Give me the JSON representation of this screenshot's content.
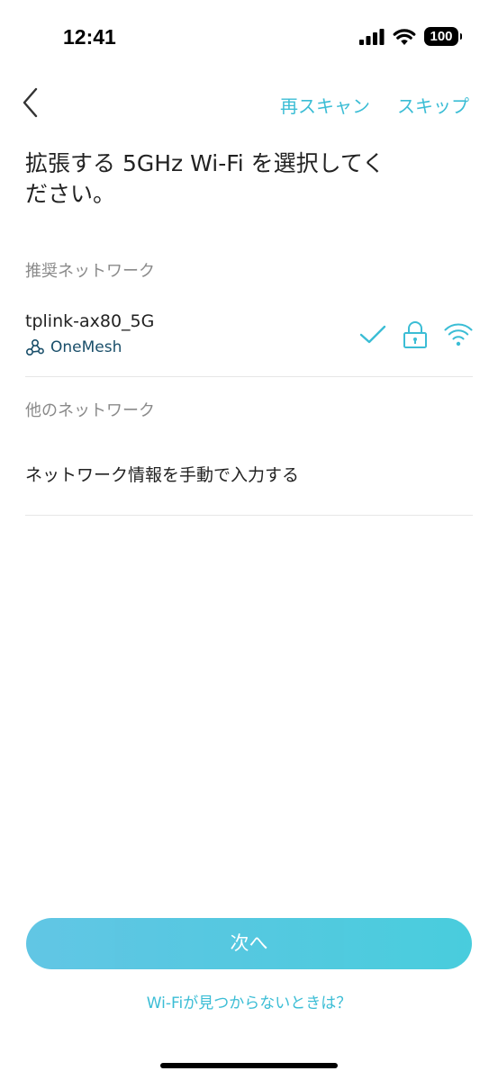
{
  "status_bar": {
    "time": "12:41",
    "battery": "100",
    "icons": [
      "cellular-signal-icon",
      "wifi-icon",
      "battery-icon"
    ]
  },
  "nav": {
    "back_icon": "chevron-left-icon",
    "rescan_label": "再スキャン",
    "skip_label": "スキップ"
  },
  "title": "拡張する 5GHz Wi-Fi を選択してください。",
  "recommended": {
    "header": "推奨ネットワーク",
    "network": {
      "name": "tplink-ax80_5G",
      "badge_label": "OneMesh",
      "badge_icon": "onemesh-icon",
      "selected": true,
      "secured": true,
      "icons": [
        "checkmark-icon",
        "lock-icon",
        "wifi-signal-icon"
      ]
    }
  },
  "other": {
    "header": "他のネットワーク",
    "manual_entry_label": "ネットワーク情報を手動で入力する"
  },
  "footer": {
    "next_label": "次へ",
    "help_label": "Wi-Fiが見つからないときは？"
  },
  "colors": {
    "accent": "#3bbdd5",
    "button": "#45c6df",
    "onemesh_text": "#1a4f6a",
    "divider": "#e6e6e6",
    "section_header": "#8a8a8a"
  }
}
